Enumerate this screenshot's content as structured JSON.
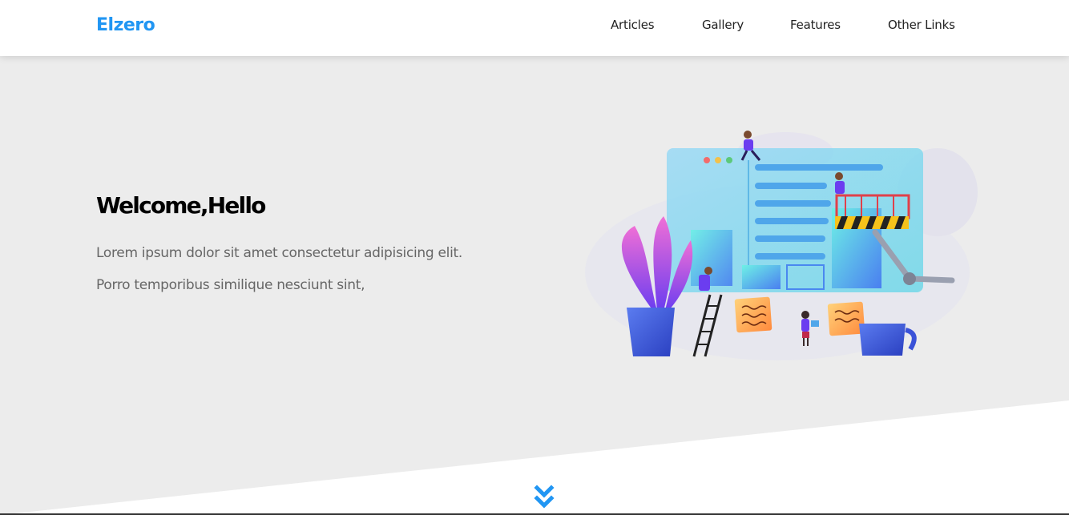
{
  "header": {
    "logo": "Elzero",
    "nav": [
      "Articles",
      "Gallery",
      "Features",
      "Other Links"
    ]
  },
  "hero": {
    "title": "Welcome,Hello",
    "lines": [
      "Lorem ipsum dolor sit amet consectetur adipisicing elit.",
      "Porro temporibus similique nesciunt sint,"
    ],
    "illustration": "website-builders-illustration"
  },
  "icons": {
    "scroll_down": "angles-down-icon"
  },
  "colors": {
    "accent": "#2196f3",
    "landing_bg": "#ececec",
    "header_bg": "#ffffff",
    "text_muted": "#666666"
  }
}
